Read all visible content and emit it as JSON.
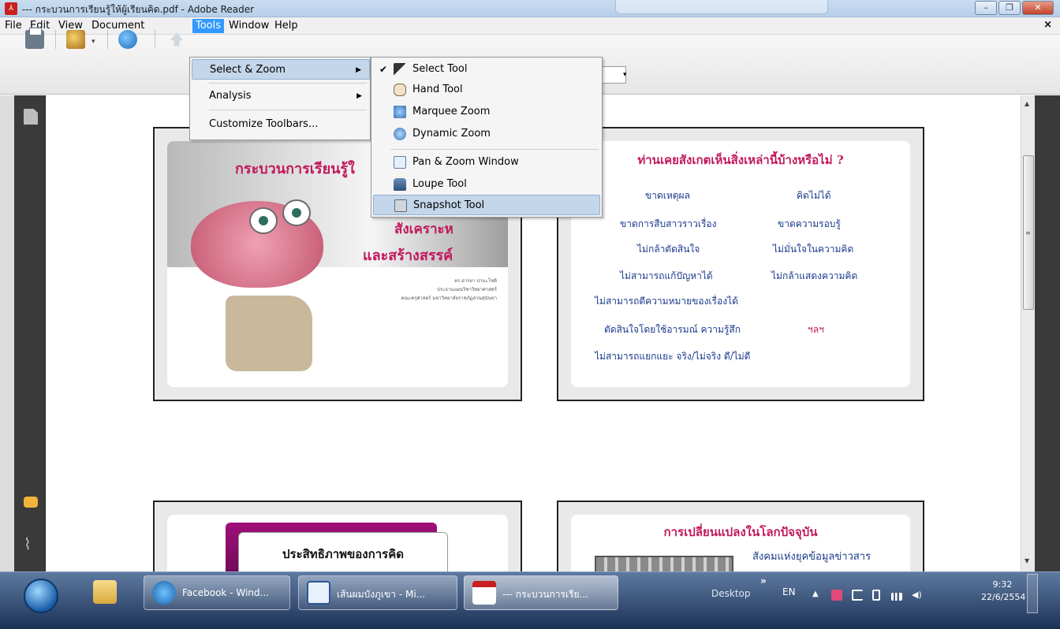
{
  "window": {
    "title": "--- กระบวนการเรียนรู้ให้ผู้เรียนคิด.pdf - Adobe Reader",
    "doc_close_glyph": "×"
  },
  "menubar": {
    "items": [
      "File",
      "Edit",
      "View",
      "Document",
      "Tools",
      "Window",
      "Help"
    ],
    "active": "Tools"
  },
  "tools_menu": {
    "items": [
      {
        "label": "Select & Zoom",
        "submenu": true,
        "highlighted": true
      },
      {
        "label": "Analysis",
        "submenu": true
      },
      {
        "label": "Customize Toolbars...",
        "submenu": false
      }
    ]
  },
  "select_zoom_submenu": {
    "items": [
      {
        "label": "Select Tool",
        "checked": true,
        "icon": "arrow-cursor-icon"
      },
      {
        "label": "Hand Tool",
        "icon": "hand-icon"
      },
      {
        "label": "Marquee Zoom",
        "icon": "marquee-zoom-icon"
      },
      {
        "label": "Dynamic Zoom",
        "icon": "dynamic-zoom-icon"
      },
      {
        "label": "Pan & Zoom Window",
        "icon": "pan-zoom-window-icon"
      },
      {
        "label": "Loupe Tool",
        "icon": "loupe-icon"
      },
      {
        "label": "Snapshot Tool",
        "icon": "camera-icon",
        "highlighted": true
      }
    ],
    "check_glyph": "✔"
  },
  "slides": {
    "s1": {
      "title_line1": "กระบวนการเรียนรู้ใ",
      "title_line2": "สังเคราะห",
      "title_line3": "และสร้างสรรค์",
      "author_lines": [
        "ดร.อารยา ปานะโชติ",
        "ประธานแผนวิชาวิทยาศาสตร์",
        "คณะครุศาสตร์ มหาวิทยาลัยราชภัฏสวนสุนันทา"
      ]
    },
    "s2": {
      "question": "ท่านเคยสังเกตเห็นสิ่งเหล่านี้บ้างหรือไม่ ?",
      "items": [
        "ขาดเหตุผล",
        "คิดไม่ได้",
        "ขาดการสืบสาวราวเรื่อง",
        "ขาดความรอบรู้",
        "ไม่กล้าตัดสินใจ",
        "ไม่มั่นใจในความคิด",
        "ไม่สามารถแก้ปัญหาได้",
        "ไม่กล้าแสดงความคิด",
        "ไม่สามารถตีความหมายของเรื่องได้",
        "ตัดสินใจโดยใช้อารมณ์ ความรู้สึก",
        "ฯลฯ",
        "ไม่สามารถแยกแยะ จริง/ไม่จริง ดี/ไม่ดี"
      ]
    },
    "s3": {
      "title": "ประสิทธิภาพของการคิด"
    },
    "s4": {
      "title": "การเปลี่ยนแปลงในโลกปัจจุบัน",
      "subtitle": "สังคมแห่งยุคข้อมูลข่าวสาร"
    }
  },
  "taskbar": {
    "apps": [
      {
        "label": "",
        "icon": "folder-icon"
      },
      {
        "label": "Facebook - Wind...",
        "icon": "ie-icon"
      },
      {
        "label": "เส้นผมบังภูเขา - Mi...",
        "icon": "word-icon"
      },
      {
        "label": "--- กระบวนการเรีย...",
        "icon": "pdf-icon"
      }
    ],
    "desktop_label": "Desktop",
    "chevron": "»",
    "lang": "EN",
    "time": "9:32",
    "date": "22/6/2554"
  },
  "colors": {
    "menu_highlight": "#3399ff",
    "slide_title": "#c2185b",
    "slide_text": "#1a3a8c"
  }
}
